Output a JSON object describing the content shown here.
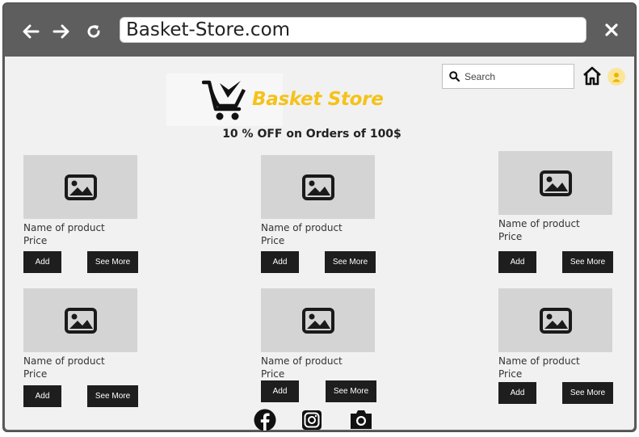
{
  "browser": {
    "url": "Basket-Store.com"
  },
  "store": {
    "name": "Basket Store",
    "promo": "10 % OFF on Orders of 100$",
    "brand_color": "#f5c219"
  },
  "search": {
    "placeholder": "Search"
  },
  "products": [
    {
      "name": "Name of product",
      "price": "Price",
      "add_label": "Add",
      "more_label": "See More"
    },
    {
      "name": "Name of product",
      "price": "Price",
      "add_label": "Add",
      "more_label": "See More"
    },
    {
      "name": "Name of product",
      "price": "Price",
      "add_label": "Add",
      "more_label": "See More"
    },
    {
      "name": "Name of product",
      "price": "Price",
      "add_label": "Add",
      "more_label": "See More"
    },
    {
      "name": "Name of product",
      "price": "Price",
      "add_label": "Add",
      "more_label": "See More"
    },
    {
      "name": "Name of product",
      "price": "Price",
      "add_label": "Add",
      "more_label": "See More"
    }
  ],
  "icons": {
    "back": "arrow-left-icon",
    "forward": "arrow-right-icon",
    "reload": "reload-icon",
    "close": "close-icon",
    "search": "search-icon",
    "home": "home-icon",
    "user": "user-icon",
    "facebook": "facebook-icon",
    "instagram": "instagram-icon",
    "camera": "camera-icon"
  }
}
